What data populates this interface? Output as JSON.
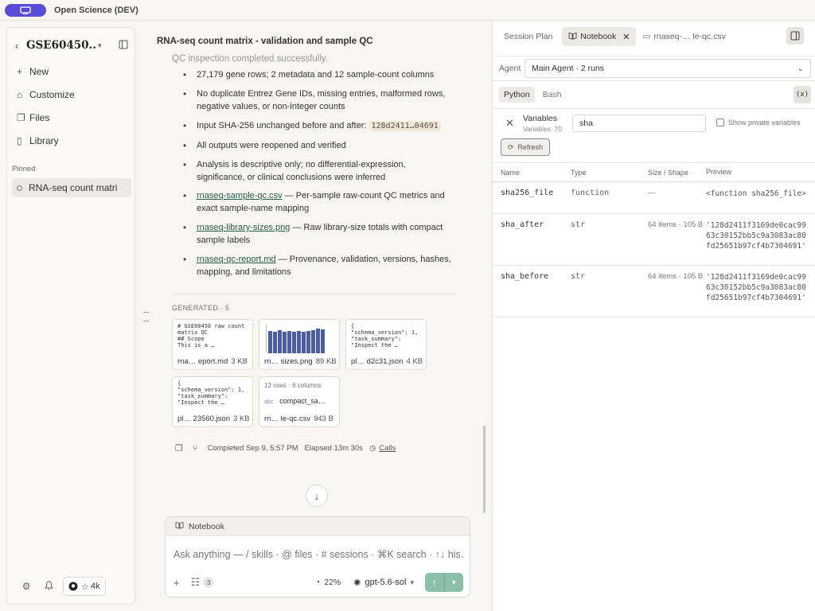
{
  "app": {
    "title": "Open Science (DEV)",
    "accent": "#5b4bd9"
  },
  "sidebar": {
    "project": "GSE60450...",
    "nav": [
      {
        "icon": "plus-icon",
        "label": "New"
      },
      {
        "icon": "customize-icon",
        "label": "Customize"
      },
      {
        "icon": "files-icon",
        "label": "Files"
      },
      {
        "icon": "library-icon",
        "label": "Library"
      }
    ],
    "pinned_label": "Pinned",
    "pinned_items": [
      "RNA-seq count matri"
    ],
    "github_stars": "4k"
  },
  "chat": {
    "title": "RNA-seq count matrix - validation and sample QC",
    "faded_line": "QC inspection completed successfully.",
    "bullets": {
      "b1": "27,179 gene rows; 2 metadata and 12 sample-count columns",
      "b2": "No duplicate Entrez Gene IDs, missing entries, malformed rows, negative values, or non-integer counts",
      "b3_prefix": "Input SHA-256 unchanged before and after: ",
      "b3_hash": "128d2411…04691",
      "b4": "All outputs were reopened and verified",
      "b5": "Analysis is descriptive only; no differential-expression, significance, or clinical conclusions were inferred",
      "b6_link": "rnaseq-sample-qc.csv",
      "b6_text": " — Per-sample raw-count QC metrics and exact sample-name mapping",
      "b7_link": "rnaseq-library-sizes.png",
      "b7_text": " — Raw library-size totals with compact sample labels",
      "b8_link": "rnaseq-qc-report.md",
      "b8_text": " — Provenance, validation, versions, hashes, mapping, and limitations"
    },
    "generated_label": "GENERATED · 5",
    "cards": {
      "c1": {
        "preview": "# GSE60450 raw count\nmatrix QC\n## Scope\nThis is a …",
        "name": "rna… eport.md",
        "size": "3 KB"
      },
      "c2": {
        "name": "rn… sizes.png",
        "size": "89 KB",
        "bars": [
          0.82,
          0.8,
          0.84,
          0.78,
          0.83,
          0.8,
          0.82,
          0.79,
          0.81,
          0.86,
          0.9,
          0.88
        ]
      },
      "c3": {
        "preview": "{\n\"schema_version\": 1,\n\"task_summary\":\n\"Inspect the …",
        "name": "pl… d2c31.json",
        "size": "4 KB"
      },
      "c4": {
        "preview": "{\n\"schema_version\": 1,\n\"task_summary\":\n\"Inspect the …",
        "name": "pl… 23560.json",
        "size": "3 KB"
      },
      "c5": {
        "meta": "12 rows · 6 columns",
        "abc": "abc",
        "col": "compact_sa…",
        "name": "rn… le-qc.csv",
        "size": "943 B"
      }
    },
    "meta": {
      "completed": "Completed Sep 9, 5:57 PM",
      "elapsed": "Elapsed 13m 30s",
      "calls": "Calls"
    }
  },
  "composer": {
    "header": "Notebook",
    "placeholder": "Ask anything — / skills · @ files · # sessions · ⌘K search · ↑↓ his…",
    "tools_count": "3",
    "context": "22%",
    "model": "gpt-5.6-sol"
  },
  "right_panel": {
    "tabs": {
      "session_plan": "Session Plan",
      "notebook": "Notebook",
      "file": "rnaseq-… le-qc.csv"
    },
    "agent_label": "Agent",
    "agent_value": "Main Agent · 2 runs",
    "langs": {
      "python": "Python",
      "bash": "Bash"
    },
    "x_button": "(x)",
    "variables": {
      "title": "Variables",
      "count": "Variables: 70",
      "search": "sha",
      "private_label": "Show private variables",
      "refresh": "Refresh"
    },
    "columns": {
      "name": "Name",
      "type": "Type",
      "size": "Size / Shape",
      "preview": "Preview"
    },
    "rows": {
      "r1": {
        "name": "sha256_file",
        "type": "function",
        "size": "—",
        "preview": "<function sha256_file>"
      },
      "r2": {
        "name": "sha_after",
        "type": "str",
        "size": "64 items · 105 B",
        "preview": "'128d2411f3169de0cac9963c30152bb5c9a3083ac80fd25651b97cf4b7304691'"
      },
      "r3": {
        "name": "sha_before",
        "type": "str",
        "size": "64 items · 105 B",
        "preview": "'128d2411f3169de0cac9963c30152bb5c9a3083ac80fd25651b97cf4b7304691'"
      }
    }
  }
}
